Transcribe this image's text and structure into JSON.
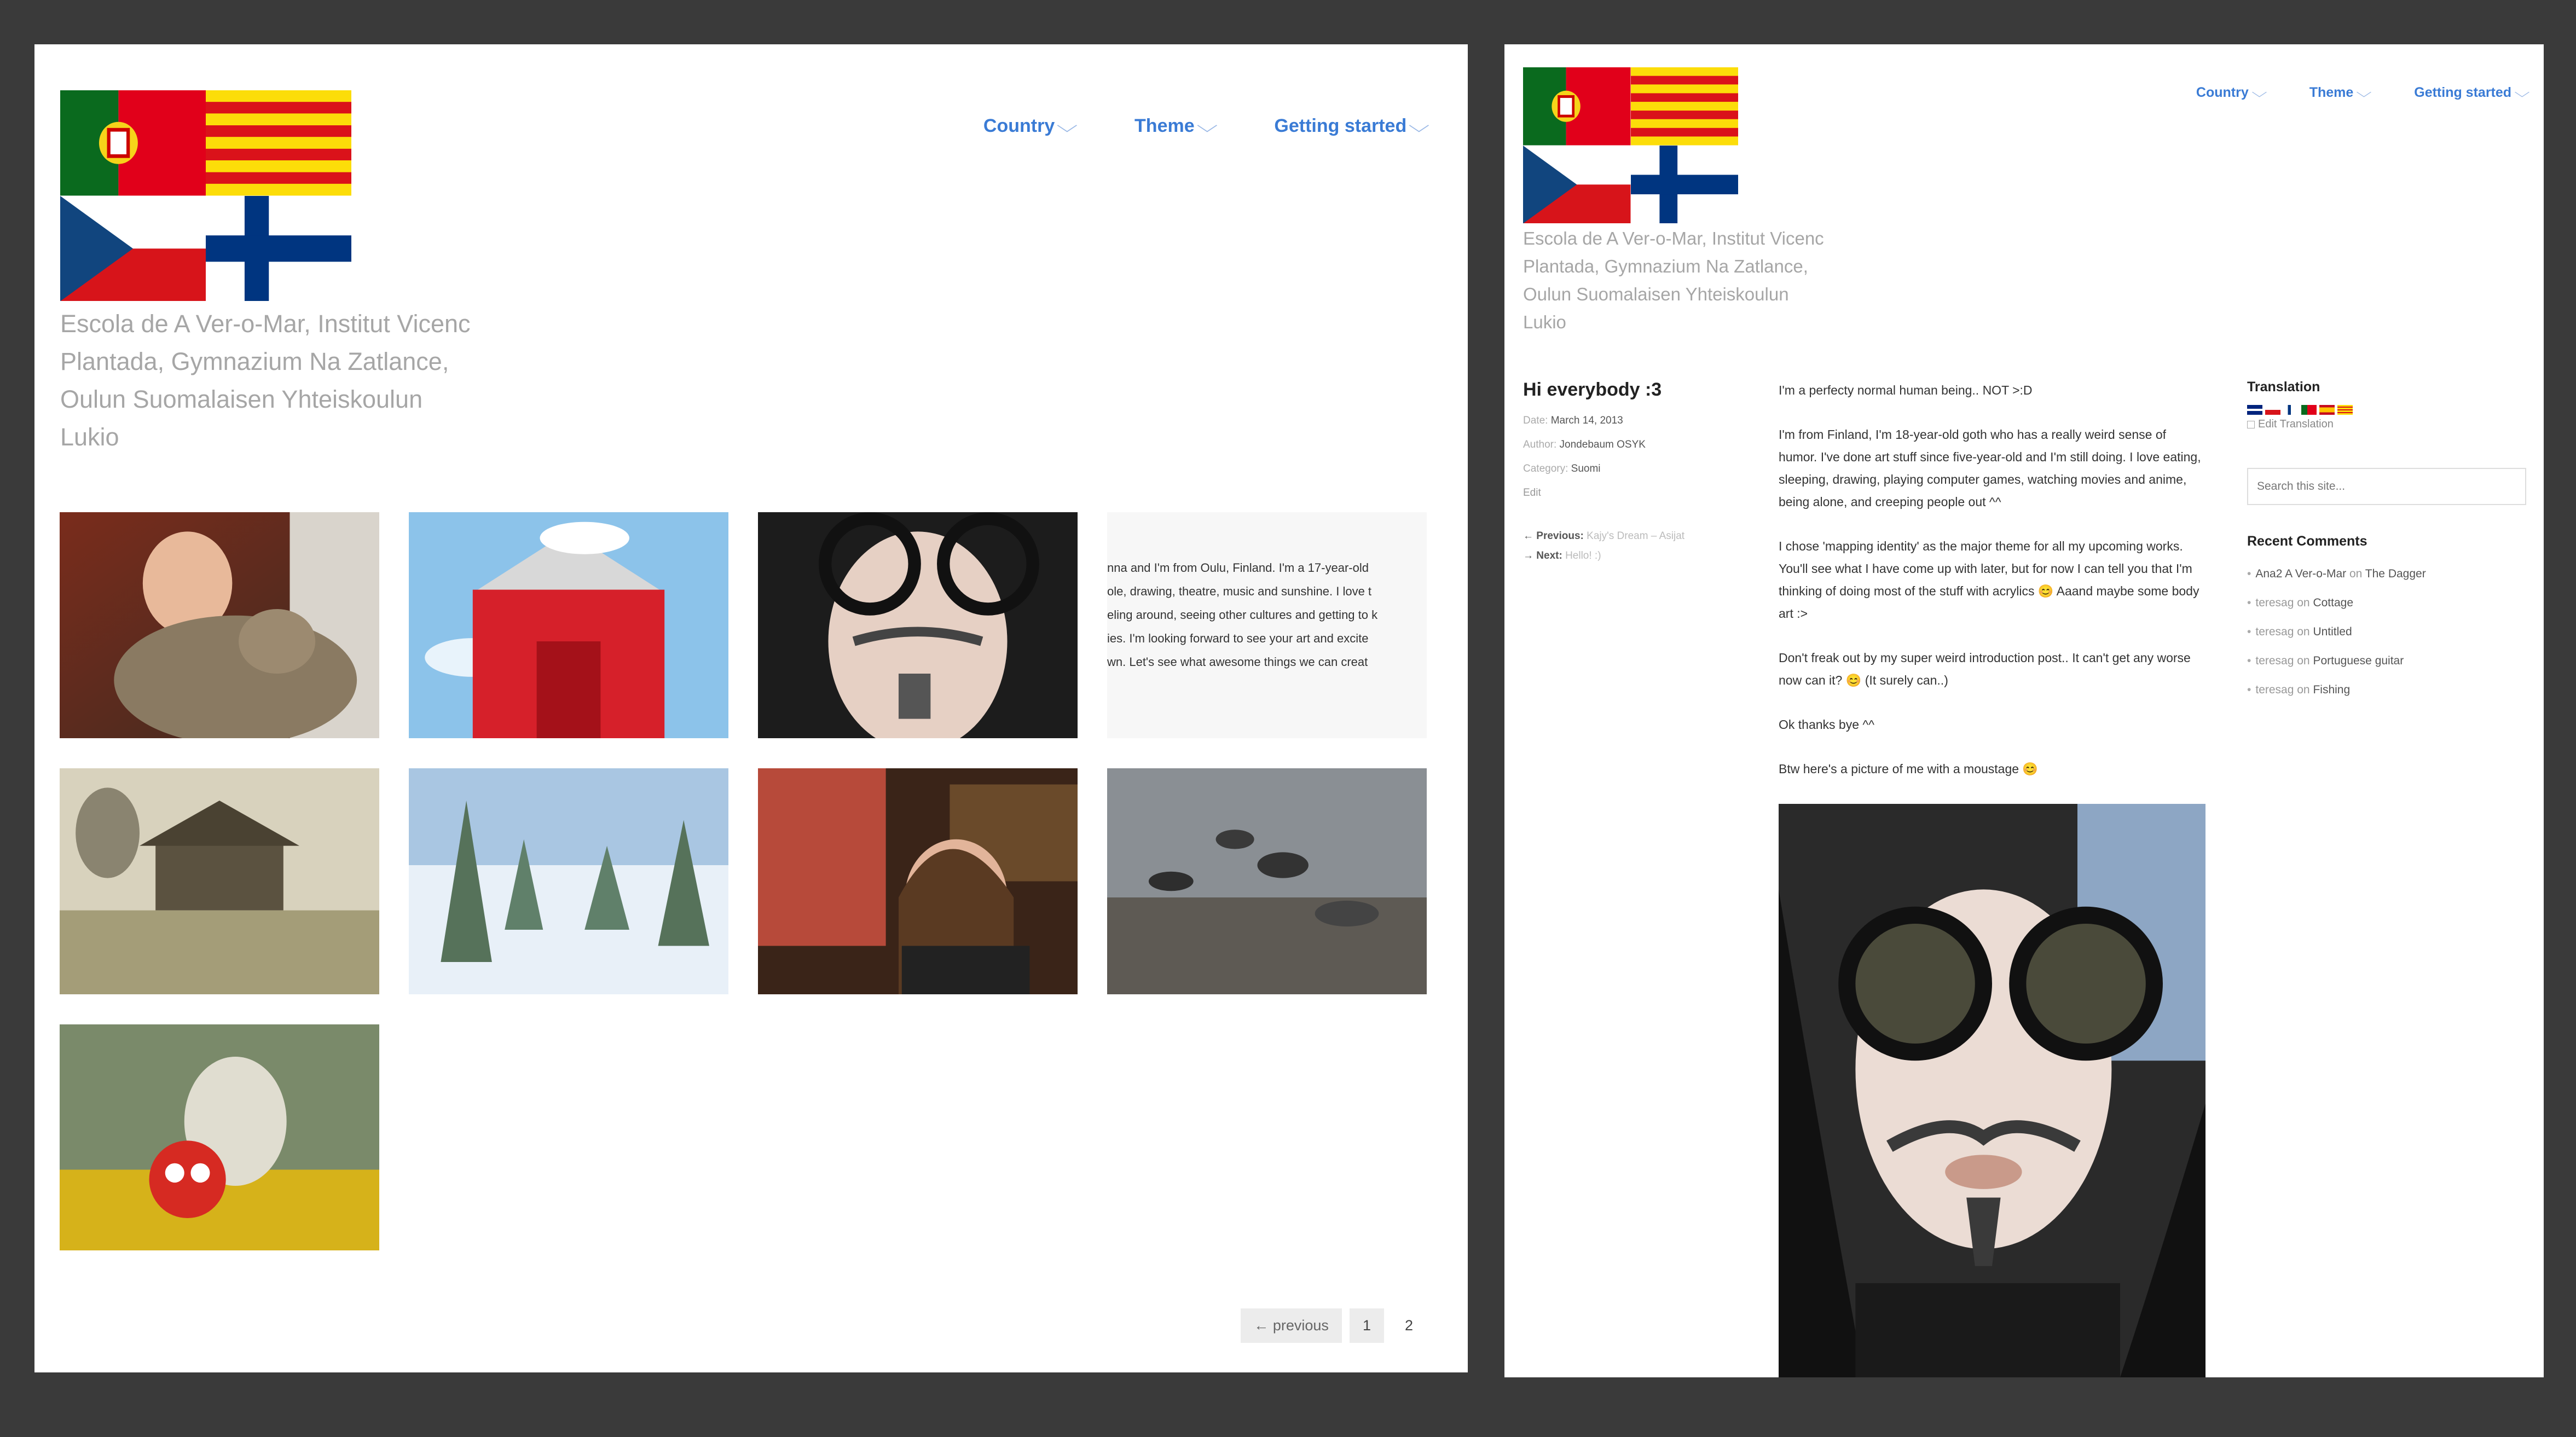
{
  "site": {
    "description_left": [
      "Escola de A Ver-o-Mar, Institut Vicenc",
      "Plantada, Gymnazium Na Zatlance,",
      "Oulun Suomalaisen Yhteiskoulun",
      "Lukio"
    ],
    "description_right": [
      "Escola de A Ver-o-Mar, Institut Vicenc",
      "Plantada, Gymnazium Na Zatlance,",
      "Oulun Suomalaisen Yhteiskoulun",
      "Lukio"
    ],
    "flags": [
      "portugal-flag",
      "catalonia-flag",
      "czech-flag",
      "finland-flag"
    ]
  },
  "nav": {
    "items": [
      {
        "label": "Country",
        "chevron": "⌵"
      },
      {
        "label": "Theme",
        "chevron": "⌵"
      },
      {
        "label": "Getting started",
        "chevron": "⌵"
      }
    ]
  },
  "grid": {
    "excerpt_lines": [
      "nna and I'm from Oulu, Finland. I'm a 17-year-old",
      "ole, drawing, theatre, music and sunshine. I love t",
      "eling around, seeing other cultures and getting to k",
      "ies. I'm looking forward to see your art and excite",
      "wn. Let's see what awesome things we can creat"
    ],
    "thumbnails": [
      "cat-portrait-photo",
      "snoopy-doghouse-image",
      "moustache-selfie-photo",
      "text-excerpt",
      "dying-daylight-house-image",
      "snowy-forest-photo",
      "girl-in-restaurant-photo",
      "rocky-shore-photo",
      "angry-bird-photo"
    ]
  },
  "pager": {
    "previous": "← previous",
    "pages": [
      "1",
      "2"
    ]
  },
  "post": {
    "title": "Hi everybody :3",
    "date_label": "Date:",
    "date": "March 14, 2013",
    "author_label": "Author:",
    "author": "Jondebaum OSYK",
    "category_label": "Category:",
    "category": "Suomi",
    "edit": "Edit",
    "prev_label": "← Previous:",
    "prev_link": "Kajy's Dream – Asijat",
    "next_label": "→ Next:",
    "next_link": "Hello! :)",
    "paragraphs": [
      "I'm a perfecty normal human being.. NOT >:D",
      "I'm from Finland, I'm 18-year-old goth who has a really weird sense of humor. I've done art stuff since five-year-old and I'm still doing. I love eating, sleeping, drawing, playing computer games, watching movies and anime, being alone, and creeping people out ^^",
      "I chose 'mapping identity' as the major theme for all my upcoming works. You'll see what I have come up with later, but for now I can tell you that I'm thinking of doing most of the stuff with acrylics 😊 Aaand maybe some body art :>",
      "Don't freak out by my super weird introduction post.. It can't get any worse now can it? 😊 (It surely can..)",
      "Ok thanks bye ^^",
      "Btw here's a picture of me with a moustage 😊"
    ]
  },
  "sidebar": {
    "translation_title": "Translation",
    "translation_edit": "Edit Translation",
    "search_placeholder": "Search this site...",
    "recent_title": "Recent Comments",
    "comments": [
      {
        "who": "Ana2 A Ver-o-Mar",
        "on": "on",
        "post": "The Dagger"
      },
      {
        "who": "teresag",
        "on": "on",
        "post": "Cottage"
      },
      {
        "who": "teresag",
        "on": "on",
        "post": "Untitled"
      },
      {
        "who": "teresag",
        "on": "on",
        "post": "Portuguese guitar"
      },
      {
        "who": "teresag",
        "on": "on",
        "post": "Fishing"
      }
    ]
  },
  "colors": {
    "background": "#3a3a3a",
    "link": "#3a7bd5",
    "muted": "#a6a6a6"
  }
}
